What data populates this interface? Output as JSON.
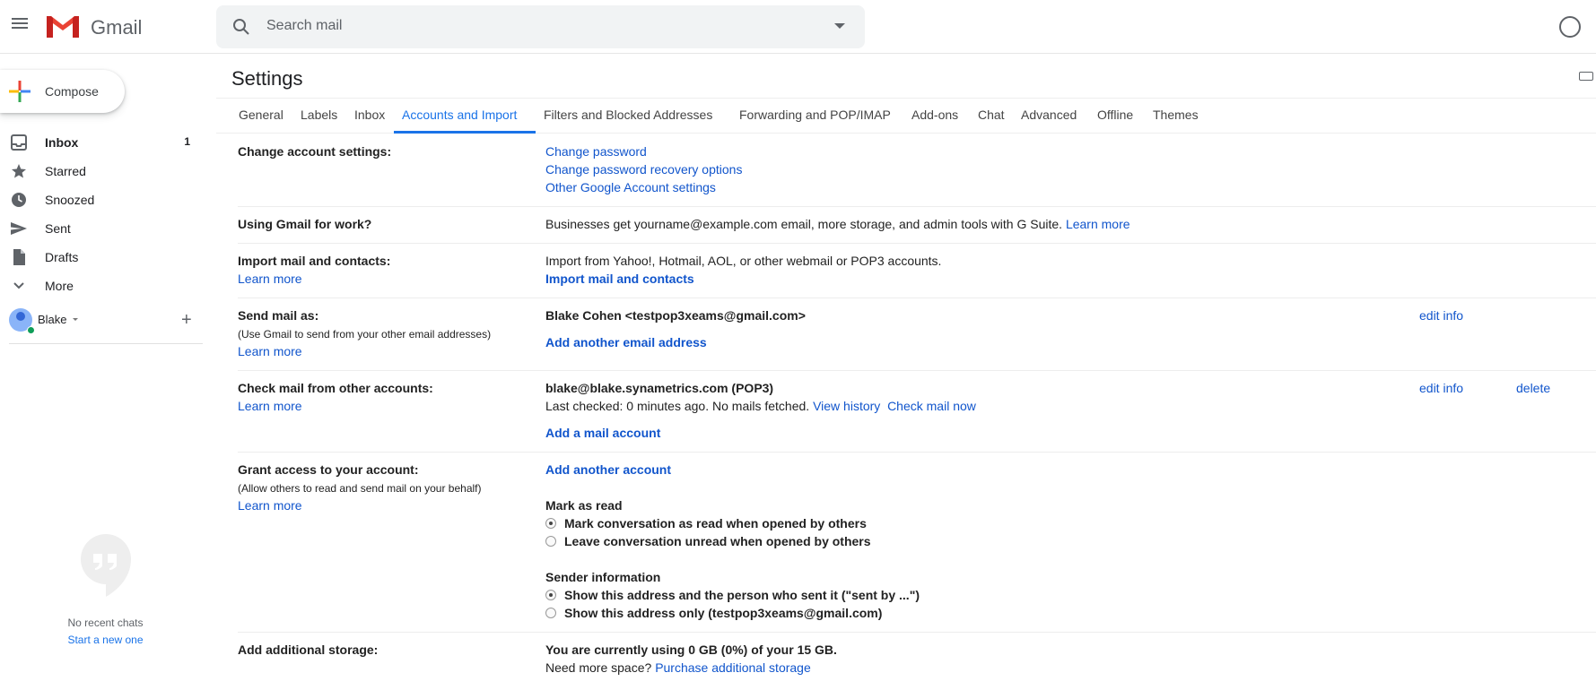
{
  "header": {
    "app_name": "Gmail",
    "search_placeholder": "Search mail"
  },
  "sidebar": {
    "compose_label": "Compose",
    "items": [
      {
        "label": "Inbox",
        "count": "1"
      },
      {
        "label": "Starred",
        "count": ""
      },
      {
        "label": "Snoozed",
        "count": ""
      },
      {
        "label": "Sent",
        "count": ""
      },
      {
        "label": "Drafts",
        "count": ""
      },
      {
        "label": "More",
        "count": ""
      }
    ],
    "user_name": "Blake",
    "add_icon": "+",
    "no_chats": "No recent chats",
    "start_new": "Start a new one"
  },
  "main": {
    "title": "Settings",
    "tabs": [
      {
        "label": "General"
      },
      {
        "label": "Labels"
      },
      {
        "label": "Inbox"
      },
      {
        "label": "Accounts and Import"
      },
      {
        "label": "Filters and Blocked Addresses"
      },
      {
        "label": "Forwarding and POP/IMAP"
      },
      {
        "label": "Add-ons"
      },
      {
        "label": "Chat"
      },
      {
        "label": "Advanced"
      },
      {
        "label": "Offline"
      },
      {
        "label": "Themes"
      }
    ],
    "active_tab": "Accounts and Import",
    "change_account": {
      "label": "Change account settings:",
      "links": [
        "Change password",
        "Change password recovery options",
        "Other Google Account settings"
      ]
    },
    "gmail_work": {
      "label": "Using Gmail for work?",
      "text": "Businesses get yourname@example.com email, more storage, and admin tools with G Suite.",
      "link": "Learn more"
    },
    "import_mail": {
      "label": "Import mail and contacts:",
      "learn_more": "Learn more",
      "text": "Import from Yahoo!, Hotmail, AOL, or other webmail or POP3 accounts.",
      "action": "Import mail and contacts"
    },
    "send_as": {
      "label": "Send mail as:",
      "sub": "(Use Gmail to send from your other email addresses)",
      "learn_more": "Learn more",
      "address": "Blake Cohen <testpop3xeams@gmail.com>",
      "edit": "edit info",
      "add": "Add another email address"
    },
    "check_mail": {
      "label": "Check mail from other accounts:",
      "learn_more": "Learn more",
      "account": "blake@blake.synametrics.com (POP3)",
      "status": "Last checked: 0 minutes ago. No mails fetched.",
      "view_history": "View history",
      "check_now": "Check mail now",
      "edit": "edit info",
      "delete": "delete",
      "add": "Add a mail account"
    },
    "grant_access": {
      "label": "Grant access to your account:",
      "sub": "(Allow others to read and send mail on your behalf)",
      "learn_more": "Learn more",
      "add": "Add another account",
      "mark_heading": "Mark as read",
      "mark_opt1": "Mark conversation as read when opened by others",
      "mark_opt2": "Leave conversation unread when opened by others",
      "sender_heading": "Sender information",
      "sender_opt1": "Show this address and the person who sent it (\"sent by ...\")",
      "sender_opt2": "Show this address only (testpop3xeams@gmail.com)"
    },
    "storage": {
      "label": "Add additional storage:",
      "usage": "You are currently using 0 GB (0%) of your 15 GB.",
      "need_more": "Need more space?",
      "purchase": "Purchase additional storage"
    }
  }
}
